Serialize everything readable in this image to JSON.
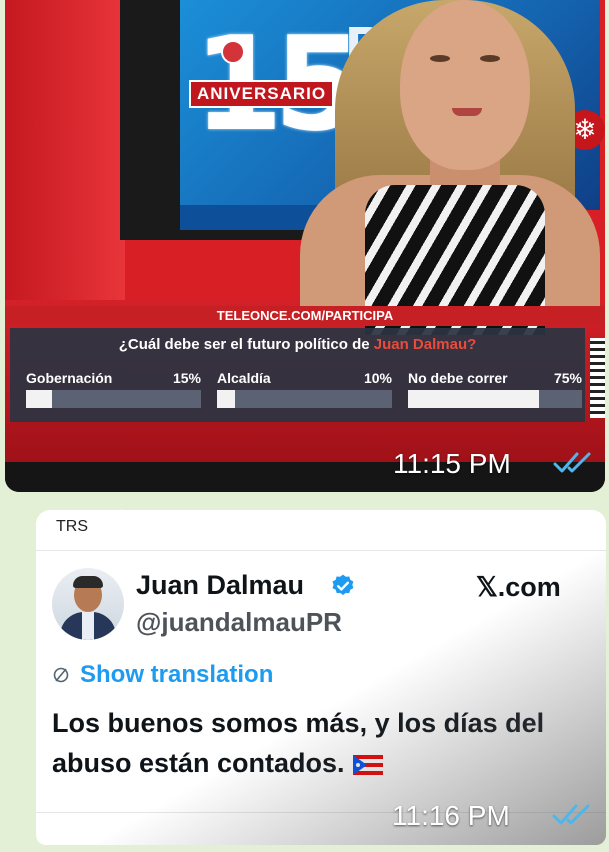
{
  "chat": {
    "message_1": {
      "broadcast": {
        "logo_number": "15",
        "logo_word": "ANIVERSARIO",
        "poll_url": "TELEONCE.COM/PARTICIPA",
        "question_prefix": "¿Cuál debe ser el futuro político de ",
        "question_highlight": "Juan Dalmau?",
        "options": [
          {
            "label": "Gobernación",
            "percent_text": "15%",
            "percent": 15
          },
          {
            "label": "Alcaldía",
            "percent_text": "10%",
            "percent": 10
          },
          {
            "label": "No debe correr",
            "percent_text": "75%",
            "percent": 75
          }
        ]
      },
      "time": "11:15 PM",
      "status_icon": "double-check-read-icon"
    },
    "message_2": {
      "sender_caption": "TRS",
      "tweet": {
        "display_name": "Juan Dalmau",
        "handle": "@juandalmauPR",
        "site": "𝕏.com",
        "verified_icon": "verified-badge-icon",
        "translate_icon": "globe-icon",
        "show_translation": "Show translation",
        "text": "Los buenos somos más, y los días del abuso están contados.",
        "flag_icon": "puerto-rico-flag-icon"
      },
      "time": "11:16 PM",
      "status_icon": "double-check-read-icon"
    }
  },
  "colors": {
    "chat_background": "#e3f0d6",
    "tick_blue": "#4fb6ec",
    "link_blue": "#1d9bf0",
    "poll_highlight": "#e94b3c"
  }
}
